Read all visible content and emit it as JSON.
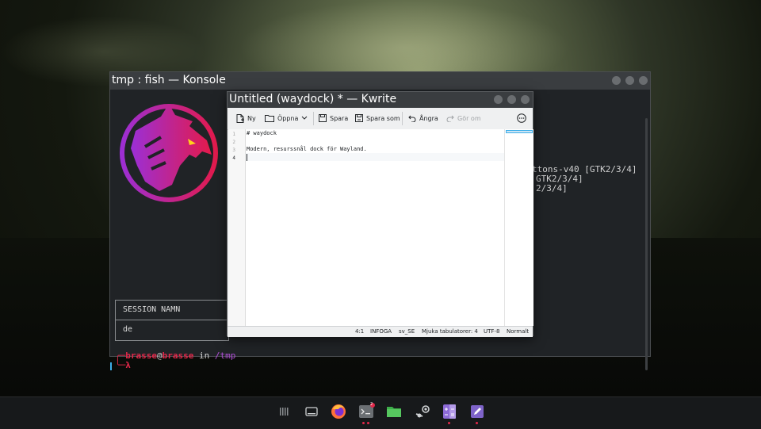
{
  "konsole": {
    "title": "tmp : fish — Konsole",
    "partial_text_1": "ttons-v40 [GTK2/3/4]",
    "partial_text_2": "GTK2/3/4]",
    "partial_text_3": "2/3/4]",
    "session_header": "SESSION NAMN",
    "session_value": "de",
    "prompt_user": "brasse",
    "prompt_at": "@",
    "prompt_host": "brasse",
    "prompt_in": " in ",
    "prompt_path": "/tmp",
    "prompt_symbol": "λ"
  },
  "kwrite": {
    "title": "Untitled (waydock) * — Kwrite",
    "toolbar": {
      "new_label": "Ny",
      "open_label": "Öppna",
      "save_label": "Spara",
      "save_as_label": "Spara som",
      "undo_label": "Ångra",
      "redo_label": "Gör om"
    },
    "lines": [
      {
        "number": "1",
        "text": "# waydock"
      },
      {
        "number": "2",
        "text": ""
      },
      {
        "number": "3",
        "text": "Modern, resurssnål dock för Wayland."
      },
      {
        "number": "4",
        "text": ""
      }
    ],
    "status": {
      "cursor": "4:1",
      "mode": "INFOGA",
      "language": "sv_SE",
      "indent": "Mjuka tabulatorer: 4",
      "encoding": "UTF-8",
      "highlight": "Normalt"
    }
  },
  "taskbar": {
    "items": [
      "apps-grid-icon",
      "desktop-icon",
      "firefox-icon",
      "terminal-icon",
      "files-icon",
      "steam-icon",
      "calculator-icon",
      "kwrite-icon"
    ],
    "terminal_badge": "2"
  },
  "colors": {
    "accent": "#3daee9",
    "prompt_red": "#e2284a",
    "path_purple": "#b14fd8"
  }
}
